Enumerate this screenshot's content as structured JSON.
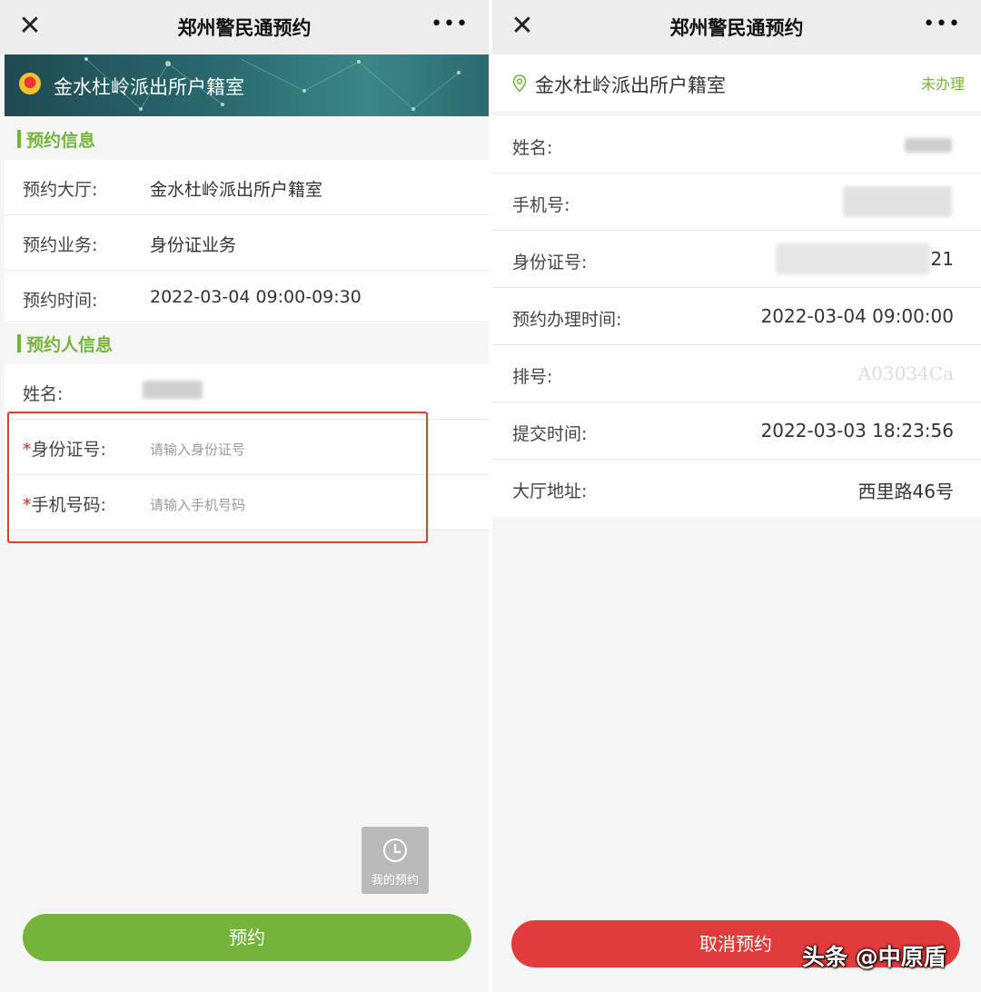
{
  "left": {
    "title": "郑州警民通预约",
    "close_icon": "close-icon",
    "more_icon": "more-icon",
    "banner": {
      "emblem": "police-emblem-icon",
      "office": "金水杜岭派出所户籍室"
    },
    "section_reservation": "预约信息",
    "hall_label": "预约大厅:",
    "hall_value": "金水杜岭派出所户籍室",
    "service_label": "预约业务:",
    "service_value": "身份证业务",
    "time_label": "预约时间:",
    "time_value": "2022-03-04 09:00-09:30",
    "section_person": "预约人信息",
    "name_label": "姓名:",
    "required_mark": "*",
    "id_label": "身份证号:",
    "id_placeholder": "请输入身份证号",
    "phone_label": "手机号码:",
    "phone_placeholder": "请输入手机号码",
    "history_icon": "clock-icon",
    "history_label": "我的预约",
    "submit_label": "预约"
  },
  "right": {
    "title": "郑州警民通预约",
    "close_icon": "close-icon",
    "more_icon": "more-icon",
    "location_icon": "location-pin-icon",
    "office": "金水杜岭派出所户籍室",
    "status": "未办理",
    "rows": [
      {
        "label": "姓名:",
        "value": ""
      },
      {
        "label": "手机号:",
        "value": ""
      },
      {
        "label": "身份证号:",
        "value": "21"
      },
      {
        "label": "预约办理时间:",
        "value": "2022-03-04 09:00:00"
      },
      {
        "label": "排号:",
        "value": "A03034Ca"
      },
      {
        "label": "提交时间:",
        "value": "2022-03-03 18:23:56"
      },
      {
        "label": "大厅地址:",
        "value": "西里路46号"
      }
    ],
    "cancel_label": "取消预约"
  },
  "watermark": "头条 @中原盾",
  "colors": {
    "accent_green": "#74b43a",
    "danger_red": "#e23b3b",
    "highlight_box": "#e23b30"
  }
}
